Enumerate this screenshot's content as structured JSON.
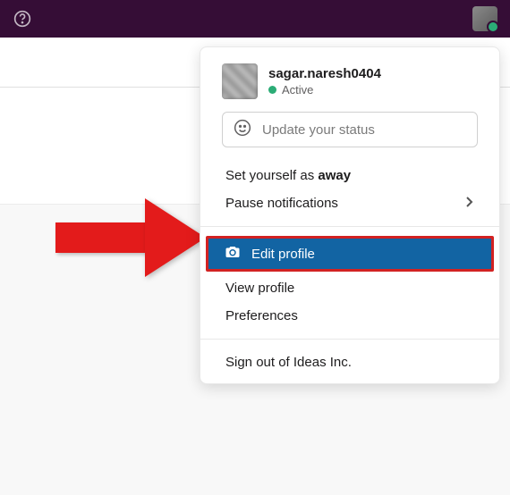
{
  "topbar": {
    "help_icon": "help-circle"
  },
  "profile": {
    "username": "sagar.naresh0404",
    "presence_label": "Active"
  },
  "status": {
    "placeholder": "Update your status"
  },
  "menu": {
    "set_away_prefix": "Set yourself as ",
    "set_away_bold": "away",
    "pause_notifications": "Pause notifications",
    "edit_profile": "Edit profile",
    "view_profile": "View profile",
    "preferences": "Preferences",
    "sign_out": "Sign out of Ideas Inc."
  }
}
